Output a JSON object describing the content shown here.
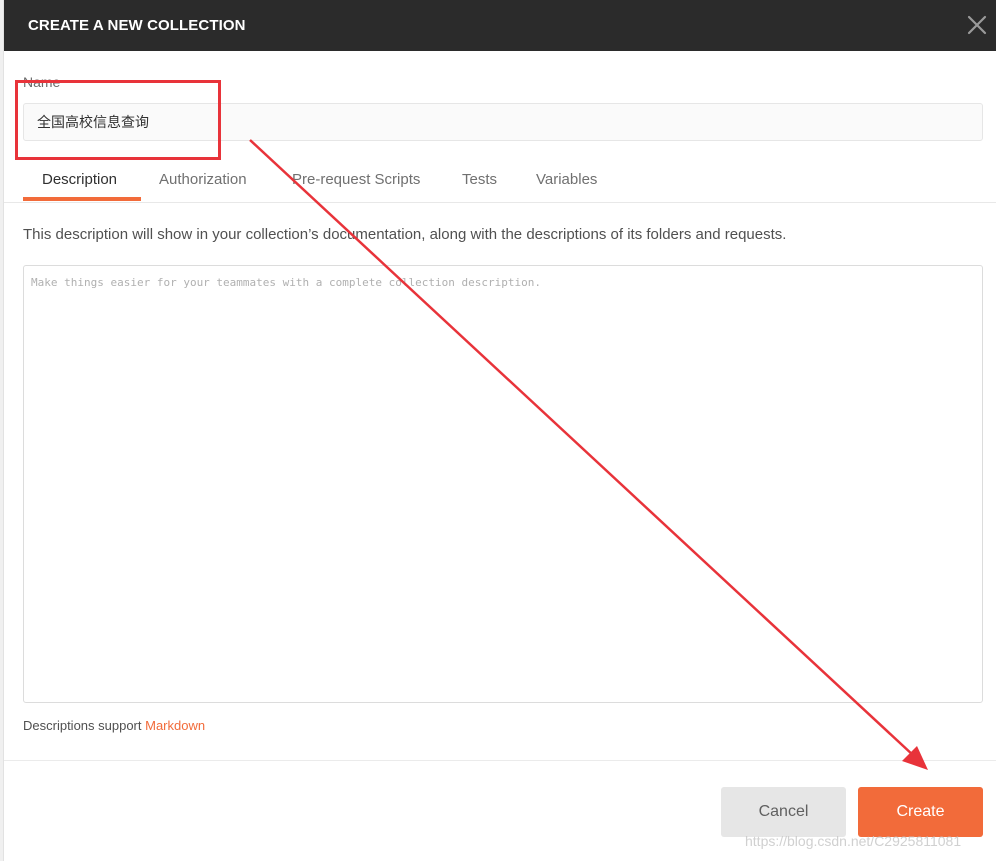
{
  "modal": {
    "title": "CREATE A NEW COLLECTION",
    "close_icon": "close-icon"
  },
  "name_field": {
    "label": "Name",
    "value": "全国高校信息查询"
  },
  "tabs": [
    {
      "label": "Description",
      "active": true
    },
    {
      "label": "Authorization",
      "active": false
    },
    {
      "label": "Pre-request Scripts",
      "active": false
    },
    {
      "label": "Tests",
      "active": false
    },
    {
      "label": "Variables",
      "active": false
    }
  ],
  "description": {
    "info": "This description will show in your collection’s documentation, along with the descriptions of its folders and requests.",
    "placeholder": "Make things easier for your teammates with a complete collection description.",
    "support_prefix": "Descriptions support ",
    "support_link": "Markdown"
  },
  "footer": {
    "cancel_label": "Cancel",
    "create_label": "Create"
  },
  "watermark": "https://blog.csdn.net/C2925811081",
  "colors": {
    "accent": "#f26b3a",
    "header_bg": "#2b2b2b",
    "annotation_red": "#e8333a"
  }
}
